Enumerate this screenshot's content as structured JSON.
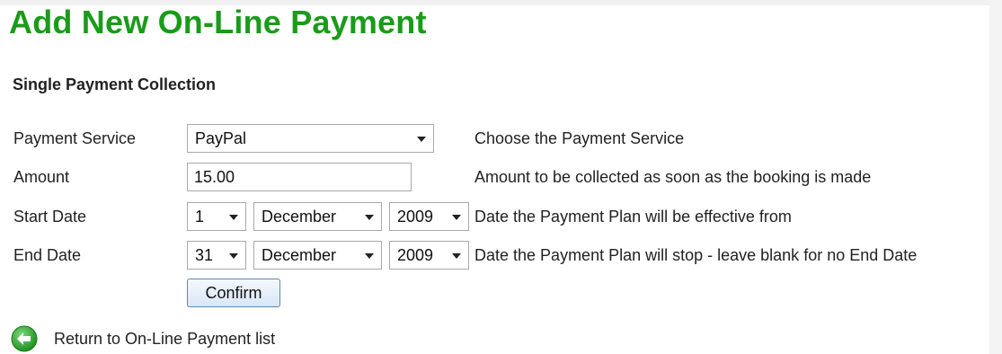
{
  "page": {
    "title": "Add New On-Line Payment",
    "section_title": "Single Payment Collection"
  },
  "form": {
    "payment_service": {
      "label": "Payment Service",
      "value": "PayPal",
      "hint": "Choose the Payment Service"
    },
    "amount": {
      "label": "Amount",
      "value": "15.00",
      "hint": "Amount to be collected as soon as the booking is made"
    },
    "start_date": {
      "label": "Start Date",
      "day": "1",
      "month": "December",
      "year": "2009",
      "hint": "Date the Payment Plan will be effective from"
    },
    "end_date": {
      "label": "End Date",
      "day": "31",
      "month": "December",
      "year": "2009",
      "hint": "Date the Payment Plan will stop - leave blank for no End Date"
    },
    "confirm_label": "Confirm"
  },
  "back_link": {
    "label": "Return to On-Line Payment list",
    "icon": "back-arrow-icon",
    "icon_color": "#2fa62f"
  },
  "colors": {
    "title": "#1a9b1a",
    "button_border": "#5a86b5"
  }
}
